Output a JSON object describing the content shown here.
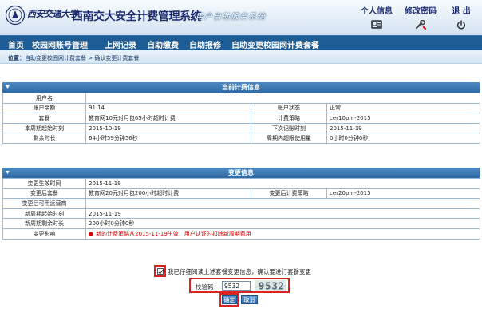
{
  "header": {
    "school_name": "西安交通大学",
    "system_title": "西南交大安全计费管理系统",
    "system_subtitle": "用户自助服务系统",
    "links": [
      {
        "label": "个人信息",
        "icon": "id-card-icon"
      },
      {
        "label": "修改密码",
        "icon": "wrench-icon"
      },
      {
        "label": "退 出",
        "icon": "power-icon"
      }
    ]
  },
  "nav": {
    "items": [
      "首页",
      "校园网账号管理",
      "上网记录",
      "自助缴费",
      "自助报修",
      "自助变更校园网计费套餐"
    ]
  },
  "breadcrumb": {
    "prefix": "位置：",
    "path": "自助变更校园网计费套餐 > 确认变更计费套餐"
  },
  "current_billing": {
    "title": "当前计费信息",
    "rows": [
      {
        "label": "用户名",
        "value": ""
      },
      {
        "label": "账户余额",
        "value": "91.14",
        "label2": "账户状态",
        "value2": "正常"
      },
      {
        "label": "套餐",
        "value": "教育网10元对月包65小时超时计费",
        "label2": "计费策略",
        "value2": "cer10pm-2015"
      },
      {
        "label": "本周期起始时刻",
        "value": "2015-10-19",
        "label2": "下次记账时刻",
        "value2": "2015-11-19"
      },
      {
        "label": "剩余时长",
        "value": "64小时59分钟56秒",
        "label2": "周期内超限使用量",
        "value2": "0小时0分钟0秒"
      }
    ]
  },
  "change_info": {
    "title": "变更信息",
    "rows": [
      {
        "label": "变更生效时间",
        "value": "2015-11-19"
      },
      {
        "label": "变更后套餐",
        "value": "教育网20元对月包200小时超时计费",
        "label2": "变更后计费策略",
        "value2": "cer20pm-2015"
      },
      {
        "label": "变更后可用运营商",
        "value": ""
      },
      {
        "label": "新周期起始时刻",
        "value": "2015-11-19"
      },
      {
        "label": "新周期剩余时长",
        "value": "200小时0分钟0秒"
      },
      {
        "label": "变更影响",
        "value": "新的计费策略从2015-11-19生效，用户认证时扣除新周期费用"
      }
    ]
  },
  "confirm": {
    "agree_text": "我已仔细阅读上述套餐变更信息，确认要进行套餐变更",
    "agree_checked": true,
    "captcha_label": "校验码：",
    "captcha_value": "9532",
    "captcha_image_text": "9532",
    "ok_label": "确定",
    "cancel_label": "取消"
  },
  "colors": {
    "nav_bg": "#1e5c96",
    "section_header": "#3a78b5",
    "warning": "#dd0000",
    "highlight_box": "#dd2222"
  }
}
